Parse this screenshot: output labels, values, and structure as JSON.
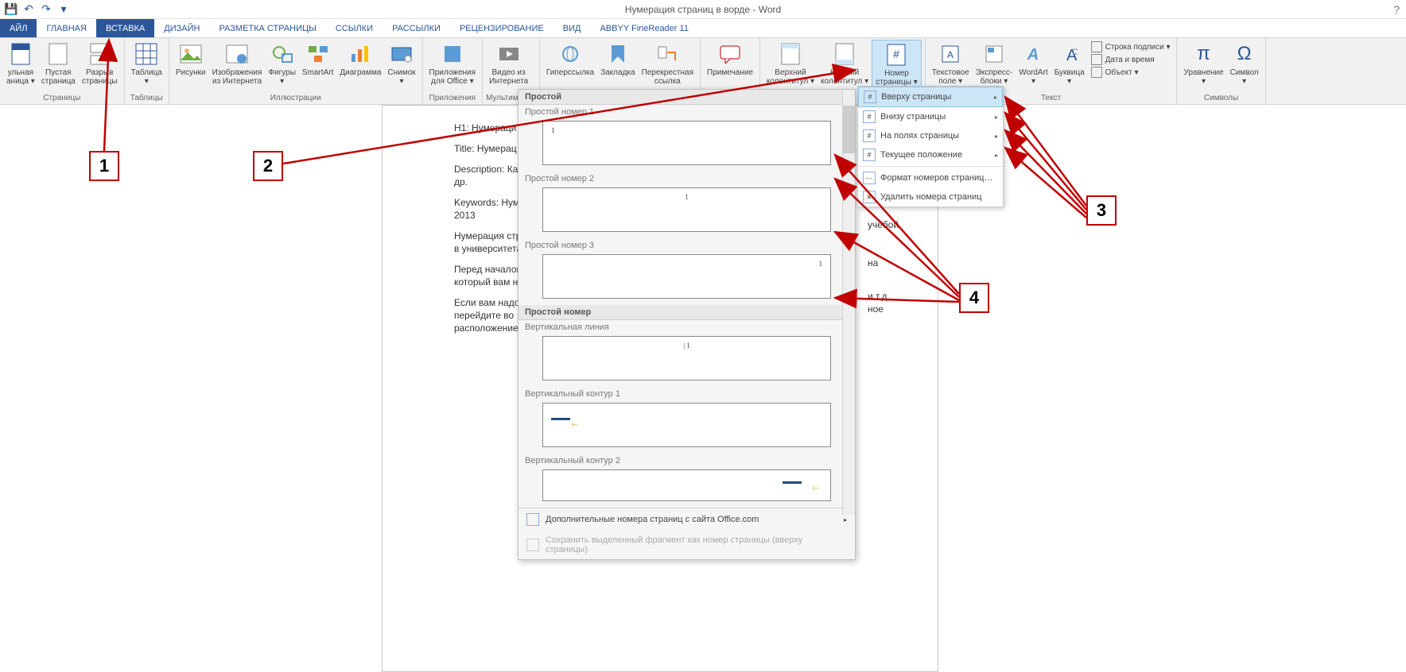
{
  "title": "Нумерация страниц в ворде - Word",
  "qat": {
    "save": "💾",
    "undo": "↶",
    "redo": "↷"
  },
  "tabs": {
    "file": "АЙЛ",
    "home": "ГЛАВНАЯ",
    "insert": "ВСТАВКА",
    "design": "ДИЗАЙН",
    "layout": "РАЗМЕТКА СТРАНИЦЫ",
    "refs": "ССЫЛКИ",
    "mail": "РАССЫЛКИ",
    "review": "РЕЦЕНЗИРОВАНИЕ",
    "view": "ВИД",
    "abbyy": "ABBYY FineReader 11"
  },
  "groups": {
    "pages": {
      "label": "Страницы",
      "cover": "ульная\nаница ▾",
      "blank": "Пустая\nстраница",
      "break": "Разрыв\nстраницы"
    },
    "tables": {
      "label": "Таблицы",
      "table": "Таблица\n▾"
    },
    "illustrations": {
      "label": "Иллюстрации",
      "pics": "Рисунки",
      "online": "Изображения\nиз Интернета",
      "shapes": "Фигуры\n▾",
      "smartart": "SmartArt",
      "chart": "Диаграмма",
      "screenshot": "Снимок\n▾"
    },
    "apps": {
      "label": "Приложения",
      "store": "Приложения\nдля Office ▾"
    },
    "media": {
      "label": "Мультимедиа",
      "video": "Видео из\nИнтернета"
    },
    "links": {
      "label": "",
      "hyper": "Гиперссылка",
      "bookmark": "Закладка",
      "crossref": "Перекрестная\nссылка"
    },
    "comments": {
      "label": "",
      "comment": "Примечание"
    },
    "hf": {
      "label": "",
      "header": "Верхний\nколонтитул ▾",
      "footer": "Нижний\nколонтитул ▾",
      "pagenum": "Номер\nстраницы ▾"
    },
    "text": {
      "label": "Текст",
      "textbox": "Текстовое\nполе ▾",
      "quickparts": "Экспресс-\nблоки ▾",
      "wordart": "WordArt\n▾",
      "dropcap": "Буквица\n▾",
      "sig": "Строка подписи ▾",
      "date": "Дата и время",
      "obj": "Объект ▾"
    },
    "symbols": {
      "label": "Символы",
      "eq": "Уравнение\n▾",
      "sym": "Символ\n▾"
    }
  },
  "submenu": {
    "top": "Вверху страницы",
    "bottom": "Внизу страницы",
    "margins": "На полях страницы",
    "current": "Текущее положение",
    "format": "Формат номеров страниц…",
    "remove": "Удалить номера страниц"
  },
  "gallery": {
    "h1": "Простой",
    "i1": "Простой номер 1",
    "i2": "Простой номер 2",
    "i3": "Простой номер 3",
    "h2": "Простой номер",
    "i4": "Вертикальная линия",
    "i5": "Вертикальный контур 1",
    "i6": "Вертикальный контур 2",
    "more": "Дополнительные номера страниц с сайта Office.com",
    "save": "Сохранить выделенный фрагмент как номер страницы (вверху страницы)"
  },
  "doc": {
    "l1": "H1: Нумераци",
    "l2": "Title: Нумерац",
    "l3": "Description: Ка",
    "l3b": "др.",
    "l4": "Keywords: Нум",
    "l4b": "2013",
    "l5": "Нумерация стр",
    "l5b": "в университета",
    "l6": "Перед началом",
    "l6b": "который вам н",
    "l7": "Если вам надо",
    "l7b": "перейдите во",
    "l7c": "расположение",
    "r1": "учебой",
    "r2": "на",
    "r3": "и т.д.",
    "r4": "ное"
  },
  "call": {
    "c1": "1",
    "c2": "2",
    "c3": "3",
    "c4": "4"
  }
}
